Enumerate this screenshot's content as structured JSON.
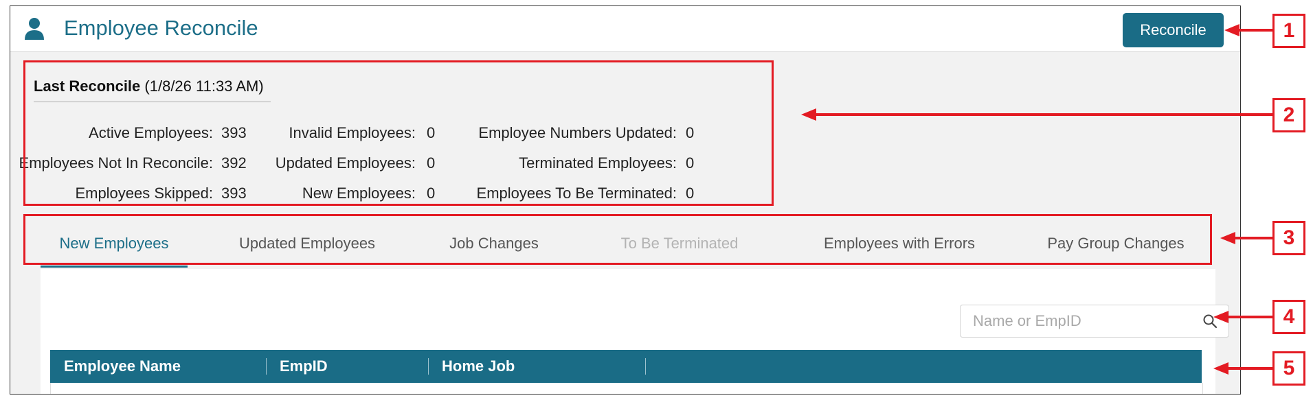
{
  "header": {
    "title": "Employee Reconcile",
    "reconcile_label": "Reconcile"
  },
  "summary": {
    "heading": "Last Reconcile",
    "timestamp": "(1/8/26 11:33 AM)",
    "stats": [
      {
        "label": "Active Employees:",
        "value": "393"
      },
      {
        "label": "Employees Not In Reconcile:",
        "value": "392"
      },
      {
        "label": "Employees Skipped:",
        "value": "393"
      },
      {
        "label": "Invalid Employees:",
        "value": "0"
      },
      {
        "label": "Updated Employees:",
        "value": "0"
      },
      {
        "label": "New Employees:",
        "value": "0"
      },
      {
        "label": "Employee Numbers Updated:",
        "value": "0"
      },
      {
        "label": "Terminated Employees:",
        "value": "0"
      },
      {
        "label": "Employees To Be Terminated:",
        "value": "0"
      }
    ]
  },
  "tabs": [
    {
      "label": "New Employees",
      "state": "active"
    },
    {
      "label": "Updated Employees",
      "state": "normal"
    },
    {
      "label": "Job Changes",
      "state": "normal"
    },
    {
      "label": "To Be Terminated",
      "state": "disabled"
    },
    {
      "label": "Employees with Errors",
      "state": "normal"
    },
    {
      "label": "Pay Group Changes",
      "state": "normal"
    }
  ],
  "search": {
    "placeholder": "Name or EmpID",
    "value": "",
    "icon": "search-icon"
  },
  "table": {
    "columns": [
      "Employee Name",
      "EmpID",
      "Home Job"
    ],
    "rows": []
  },
  "annotations": [
    "1",
    "2",
    "3",
    "4",
    "5"
  ],
  "colors": {
    "accent": "#1a6c86",
    "title": "#1c6e88",
    "annotation": "#e31b23",
    "background": "#f2f2f2"
  }
}
